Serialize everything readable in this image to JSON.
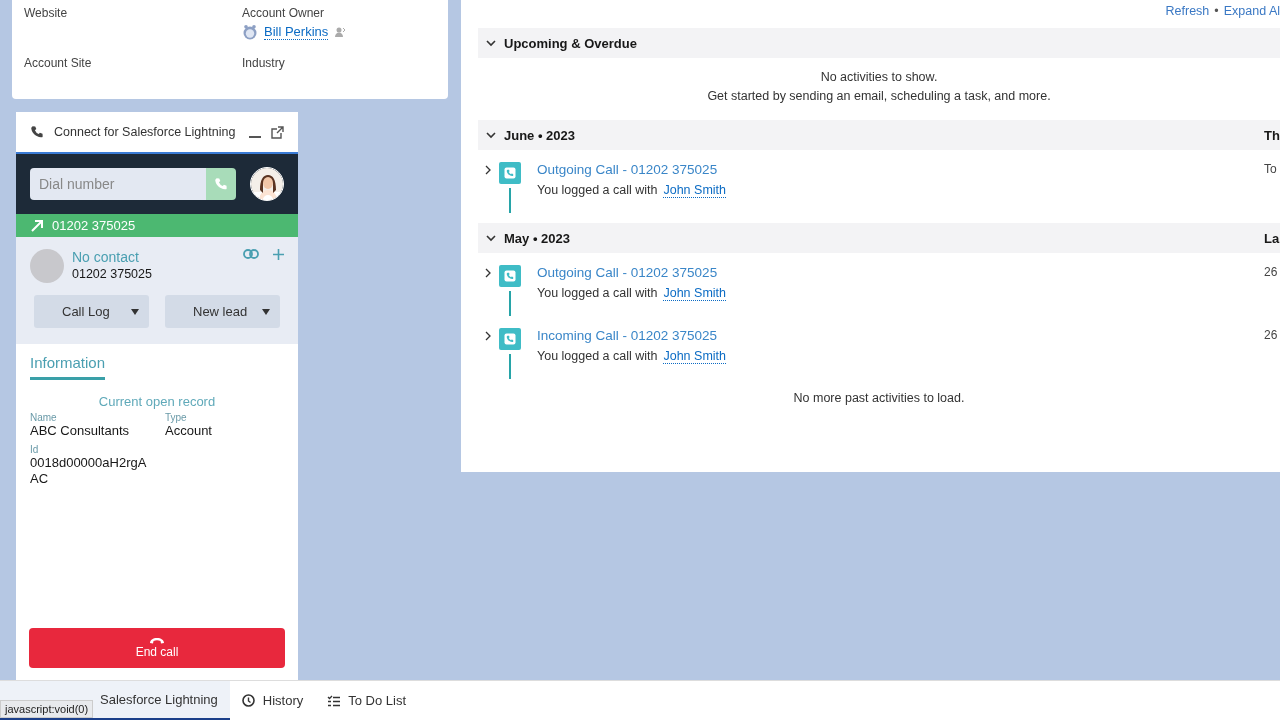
{
  "account_fields": [
    {
      "label": "Website"
    },
    {
      "label": "Account Owner",
      "value": "Bill Perkins"
    },
    {
      "label": "Account Site"
    },
    {
      "label": "Industry"
    }
  ],
  "softphone": {
    "title": "Connect for Salesforce Lightning",
    "dial": {
      "placeholder": "Dial number"
    },
    "active_call": {
      "number": "01202 375025"
    },
    "contact": {
      "name": "No contact",
      "number": "01202 375025"
    },
    "buttons": [
      "Call Log",
      "New lead"
    ],
    "tabs": [
      {
        "label": "Information",
        "selected": true
      }
    ],
    "info": {
      "heading": "Current open record",
      "fields": [
        {
          "label": "Name",
          "value": "ABC Consultants"
        },
        {
          "label": "Type",
          "value": "Account"
        },
        {
          "label": "Id",
          "value": "0018d00000aH2rgAAC"
        }
      ]
    },
    "end_call": "End call"
  },
  "activity": {
    "actions": [
      "Refresh",
      "Expand Al"
    ],
    "separator": "•",
    "sections": [
      {
        "title": "Upcoming & Overdue",
        "expanded": true,
        "empty": [
          "No activities to show.",
          "Get started by sending an email, scheduling a task, and more."
        ]
      },
      {
        "title": "June • 2023",
        "expanded": true,
        "right": "Th",
        "items": [
          {
            "title": "Outgoing Call - 01202 375025",
            "text": "You logged a call with",
            "who": "John Smith",
            "date": "To",
            "expanded": false
          }
        ]
      },
      {
        "title": "May • 2023",
        "expanded": true,
        "right": "La",
        "items": [
          {
            "title": "Outgoing Call - 01202 375025",
            "text": "You logged a call with",
            "who": "John Smith",
            "date": "26",
            "expanded": false
          },
          {
            "title": "Incoming Call - 01202 375025",
            "text": "You logged a call with",
            "who": "John Smith",
            "date": "26",
            "expanded": false
          }
        ]
      }
    ],
    "footer": "No more past activities to load."
  },
  "utility_bar": [
    {
      "kind": "app",
      "label": "Salesforce Lightning",
      "selected": true
    },
    {
      "kind": "history",
      "label": "History",
      "selected": false
    },
    {
      "kind": "todo",
      "label": "To Do List",
      "selected": false
    }
  ],
  "status_tooltip": "javascript:void(0)"
}
